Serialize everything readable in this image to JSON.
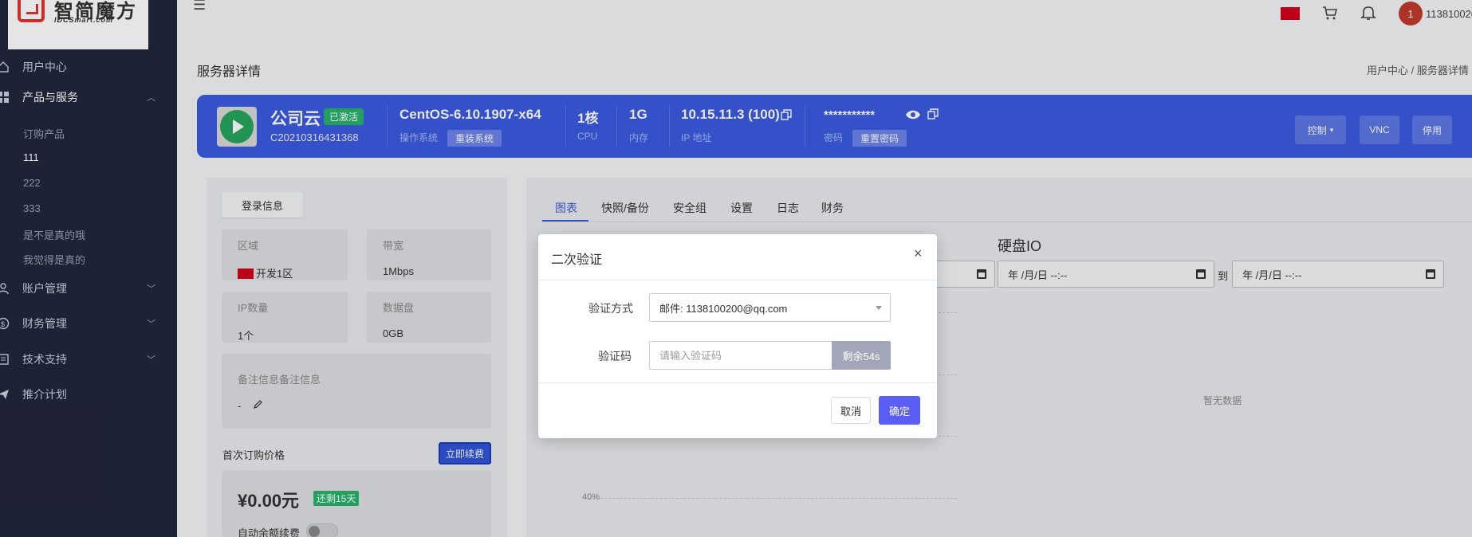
{
  "logo": {
    "text": "智简魔方",
    "sub": "IDCSmart.com"
  },
  "sidebar": {
    "items": [
      {
        "label": "用户中心"
      },
      {
        "label": "产品与服务"
      },
      {
        "label": "账户管理"
      },
      {
        "label": "财务管理"
      },
      {
        "label": "技术支持"
      },
      {
        "label": "推介计划"
      }
    ],
    "sub_items": [
      "订购产品",
      "111",
      "222",
      "333",
      "是不是真的哦",
      "我觉得是真的"
    ]
  },
  "topbar": {
    "avatar_letter": "1",
    "username": "113810020"
  },
  "page": {
    "title": "服务器详情",
    "breadcrumb": "用户中心  /  服务器详情"
  },
  "banner": {
    "name": "公司云",
    "status": "已激活",
    "id": "C20210316431368",
    "os": "CentOS-6.10.1907-x64",
    "os_label": "操作系统",
    "reinstall": "重装系统",
    "cpu": "1核",
    "cpu_label": "CPU",
    "mem": "1G",
    "mem_label": "内存",
    "ip": "10.15.11.3 (100)",
    "ip_label": "IP 地址",
    "password": "***********",
    "password_label": "密码",
    "reset_password": "重置密码",
    "control": "控制",
    "vnc": "VNC",
    "stop": "停用"
  },
  "left": {
    "login_info": "登录信息",
    "region_label": "区域",
    "region_value": "开发1区",
    "bandwidth_label": "带宽",
    "bandwidth_value": "1Mbps",
    "ip_count_label": "IP数量",
    "ip_count_value": "1个",
    "disk_label": "数据盘",
    "disk_value": "0GB",
    "note_label": "备注信息备注信息",
    "note_value": "-",
    "price_label": "首次订购价格",
    "renew": "立即续费",
    "price": "¥0.00元",
    "remaining": "还剩15天",
    "auto_renew": "自动余额续费"
  },
  "tabs": [
    "图表",
    "快照/备份",
    "安全组",
    "设置",
    "日志",
    "财务"
  ],
  "chart": {
    "title": "硬盘IO",
    "date_placeholder": "年 /月/日 --:--",
    "to": "到",
    "no_data": "暂无数据",
    "y_tick": "40%"
  },
  "modal": {
    "title": "二次验证",
    "method_label": "验证方式",
    "method_value": "邮件: 1138100200@qq.com",
    "code_label": "验证码",
    "code_placeholder": "请输入验证码",
    "countdown": "剩余54s",
    "cancel": "取消",
    "confirm": "确定"
  },
  "colors": {
    "accent": "#3b5be0",
    "sidebar": "#21263a",
    "success": "#27b26a",
    "confirm": "#5b5ef5"
  }
}
